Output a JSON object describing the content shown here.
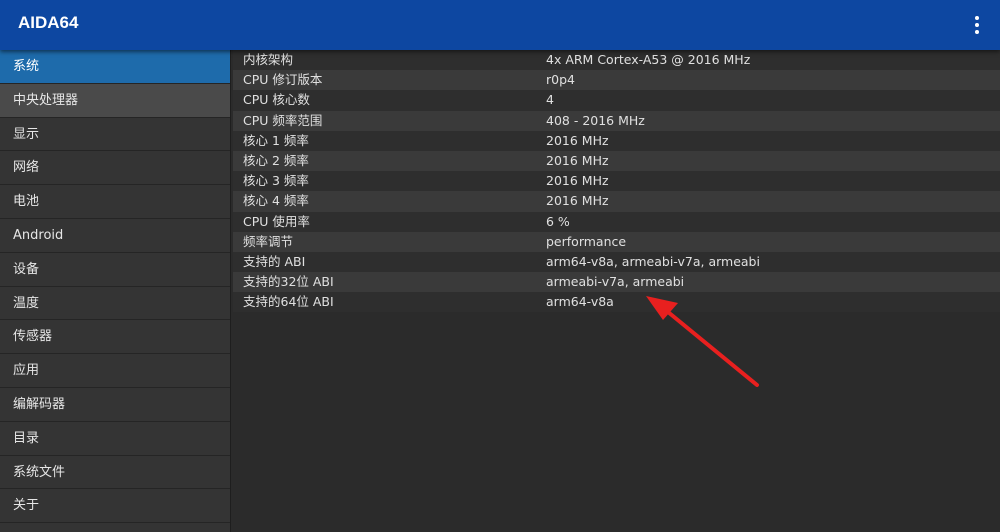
{
  "app": {
    "title": "AIDA64",
    "menu_icon": "more-vert-icon"
  },
  "sidebar": {
    "items": [
      {
        "label": "系统"
      },
      {
        "label": "中央处理器"
      },
      {
        "label": "显示"
      },
      {
        "label": "网络"
      },
      {
        "label": "电池"
      },
      {
        "label": "Android"
      },
      {
        "label": "设备"
      },
      {
        "label": "温度"
      },
      {
        "label": "传感器"
      },
      {
        "label": "应用"
      },
      {
        "label": "编解码器"
      },
      {
        "label": "目录"
      },
      {
        "label": "系统文件"
      },
      {
        "label": "关于"
      }
    ],
    "active_index": 0,
    "highlight_index": 1
  },
  "details": {
    "rows": [
      {
        "key": "内核架构",
        "value": "4x ARM Cortex-A53 @ 2016 MHz"
      },
      {
        "key": "CPU 修订版本",
        "value": "r0p4"
      },
      {
        "key": "CPU 核心数",
        "value": "4"
      },
      {
        "key": "CPU 频率范围",
        "value": "408 - 2016 MHz"
      },
      {
        "key": "核心 1 频率",
        "value": "2016 MHz"
      },
      {
        "key": "核心 2 频率",
        "value": "2016 MHz"
      },
      {
        "key": "核心 3 频率",
        "value": "2016 MHz"
      },
      {
        "key": "核心 4 频率",
        "value": "2016 MHz"
      },
      {
        "key": "CPU 使用率",
        "value": "6 %"
      },
      {
        "key": "频率调节",
        "value": "performance"
      },
      {
        "key": "支持的 ABI",
        "value": "arm64-v8a, armeabi-v7a, armeabi"
      },
      {
        "key": "支持的32位 ABI",
        "value": "armeabi-v7a, armeabi"
      },
      {
        "key": "支持的64位 ABI",
        "value": "arm64-v8a"
      }
    ]
  },
  "colors": {
    "appbar": "#0d47a1",
    "sidebar_active": "#1e6bab",
    "annotation_arrow": "#e8201f"
  }
}
